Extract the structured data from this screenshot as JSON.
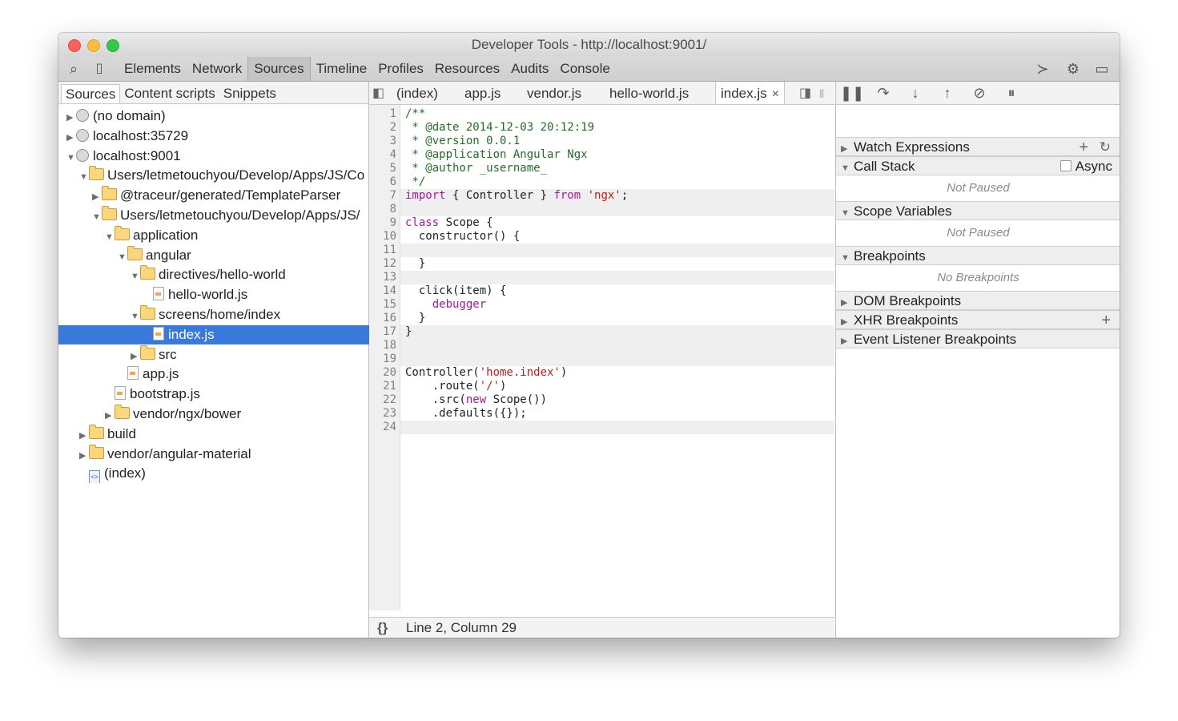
{
  "window": {
    "title": "Developer Tools - http://localhost:9001/"
  },
  "toolbar": {
    "search_icon": "search-icon",
    "device_icon": "device-icon",
    "tabs": [
      "Elements",
      "Network",
      "Sources",
      "Timeline",
      "Profiles",
      "Resources",
      "Audits",
      "Console"
    ],
    "active_tab": "Sources",
    "right_icons": [
      "console-drawer-icon",
      "gear-icon",
      "dock-icon"
    ]
  },
  "navigator": {
    "tabs": [
      "Sources",
      "Content scripts",
      "Snippets"
    ],
    "active_tab": "Sources",
    "tree": [
      {
        "label": "(no domain)",
        "arrow": "▶",
        "icon": "globe"
      },
      {
        "label": "localhost:35729",
        "arrow": "▶",
        "icon": "globe"
      },
      {
        "label": "localhost:9001",
        "arrow": "▼",
        "icon": "globe"
      },
      {
        "label": "Users/letmetouchyou/Develop/Apps/JS/Co",
        "arrow": "▼",
        "icon": "folder"
      },
      {
        "label": "@traceur/generated/TemplateParser",
        "arrow": "▶",
        "icon": "folder"
      },
      {
        "label": "Users/letmetouchyou/Develop/Apps/JS/",
        "arrow": "▼",
        "icon": "folder"
      },
      {
        "label": "application",
        "arrow": "▼",
        "icon": "folder"
      },
      {
        "label": "angular",
        "arrow": "▼",
        "icon": "folder"
      },
      {
        "label": "directives/hello-world",
        "arrow": "▼",
        "icon": "folder"
      },
      {
        "label": "hello-world.js",
        "arrow": "",
        "icon": "file"
      },
      {
        "label": "screens/home/index",
        "arrow": "▼",
        "icon": "folder"
      },
      {
        "label": "index.js",
        "arrow": "",
        "icon": "file",
        "selected": true
      },
      {
        "label": "src",
        "arrow": "▶",
        "icon": "folder"
      },
      {
        "label": "app.js",
        "arrow": "",
        "icon": "file"
      },
      {
        "label": "bootstrap.js",
        "arrow": "",
        "icon": "file"
      },
      {
        "label": "vendor/ngx/bower",
        "arrow": "▶",
        "icon": "folder"
      },
      {
        "label": "build",
        "arrow": "▶",
        "icon": "folder"
      },
      {
        "label": "vendor/angular-material",
        "arrow": "▶",
        "icon": "folder"
      },
      {
        "label": "(index)",
        "arrow": "",
        "icon": "html"
      }
    ]
  },
  "editor": {
    "tabs": [
      "(index)",
      "app.js",
      "vendor.js",
      "hello-world.js",
      "index.js"
    ],
    "active_tab": "index.js",
    "close_glyph": "×",
    "line_numbers": [
      "1",
      "2",
      "3",
      "4",
      "5",
      "6",
      "7",
      "8",
      "9",
      "10",
      "11",
      "12",
      "13",
      "14",
      "15",
      "16",
      "17",
      "18",
      "19",
      "20",
      "21",
      "22",
      "23",
      "24"
    ],
    "status": {
      "format_icon": "{}",
      "position": "Line 2, Column 29"
    }
  },
  "debugger": {
    "toolbar_icons": [
      "pause-icon",
      "step-over-icon",
      "step-into-icon",
      "step-out-icon",
      "deactivate-breakpoints-icon",
      "pause-on-exceptions-icon"
    ],
    "sections": {
      "watch": "Watch Expressions",
      "call_stack": "Call Stack",
      "async_label": "Async",
      "not_paused_1": "Not Paused",
      "scope": "Scope Variables",
      "not_paused_2": "Not Paused",
      "breakpoints": "Breakpoints",
      "no_breakpoints": "No Breakpoints",
      "dom_breakpoints": "DOM Breakpoints",
      "xhr_breakpoints": "XHR Breakpoints",
      "event_listener_breakpoints": "Event Listener Breakpoints"
    }
  },
  "colors": {
    "selection": "#3879d9",
    "comment": "#236e25",
    "keyword": "#a8179c",
    "string": "#c41a16"
  }
}
